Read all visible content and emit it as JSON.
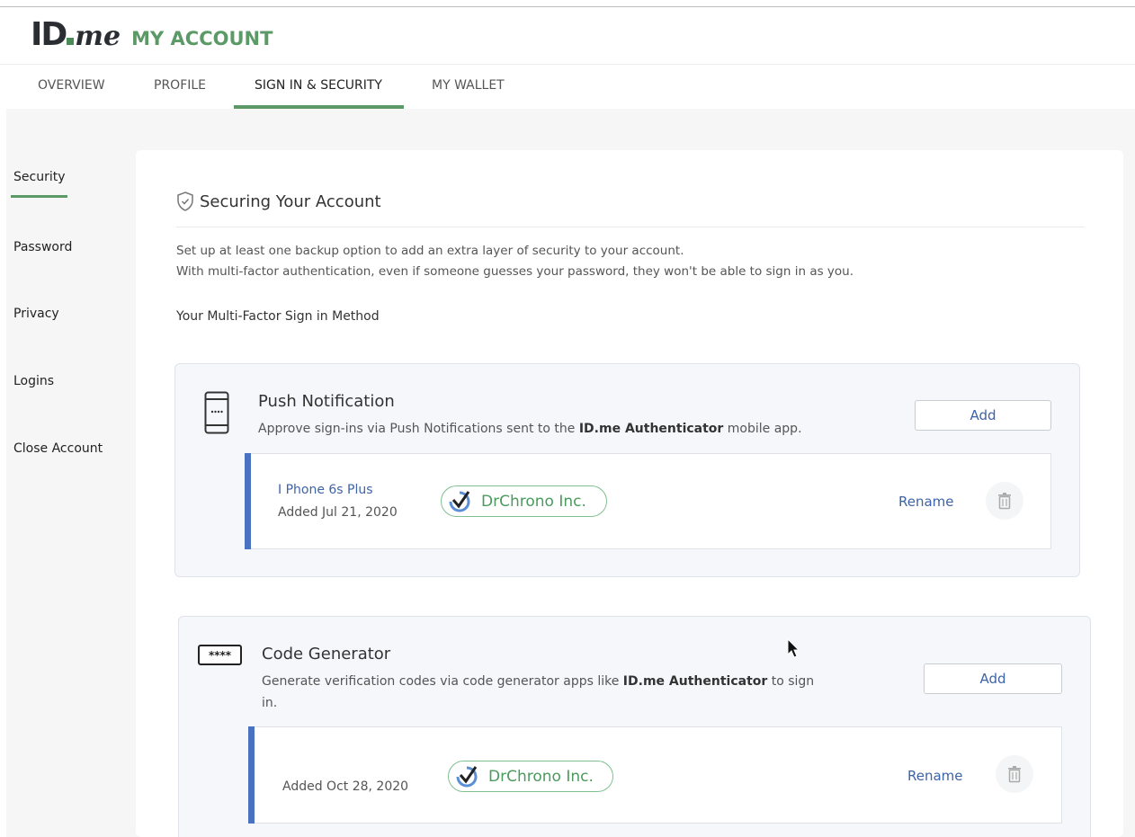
{
  "brand": {
    "logo_id": "ID",
    "logo_me": "me",
    "section": "MY ACCOUNT",
    "accent_color": "#5b9a66"
  },
  "tabs": [
    {
      "label": "OVERVIEW",
      "active": false
    },
    {
      "label": "PROFILE",
      "active": false
    },
    {
      "label": "SIGN IN & SECURITY",
      "active": true
    },
    {
      "label": "MY WALLET",
      "active": false
    }
  ],
  "sidebar": {
    "items": [
      {
        "label": "Security",
        "active": true
      },
      {
        "label": "Password",
        "active": false
      },
      {
        "label": "Privacy",
        "active": false
      },
      {
        "label": "Logins",
        "active": false
      },
      {
        "label": "Close Account",
        "active": false
      }
    ]
  },
  "main": {
    "title": "Securing Your Account",
    "title_icon": "shield-check-icon",
    "desc_line1": "Set up at least one backup option to add an extra layer of security to your account.",
    "desc_line2": "With multi-factor authentication, even if someone guesses your password, they won't be able to sign in as you.",
    "mfa_label": "Your Multi-Factor Sign in Method"
  },
  "methods": [
    {
      "icon": "mobile-phone-icon",
      "title": "Push Notification",
      "desc_before": "Approve sign-ins via Push Notifications sent to the ",
      "desc_bold": "ID.me Authenticator",
      "desc_after": " mobile app.",
      "add_label": "Add",
      "device": {
        "name": "I Phone 6s Plus",
        "added": "Added Jul 21, 2020",
        "badge": "DrChrono Inc.",
        "rename_label": "Rename"
      }
    },
    {
      "icon": "passcode-icon",
      "title": "Code Generator",
      "desc_before": "Generate verification codes via code generator apps like ",
      "desc_bold": "ID.me Authenticator",
      "desc_after": " to sign in.",
      "add_label": "Add",
      "device": {
        "name": "",
        "added": "Added Oct 28, 2020",
        "badge": "DrChrono Inc.",
        "rename_label": "Rename"
      }
    }
  ],
  "passcode_glyph": "****"
}
